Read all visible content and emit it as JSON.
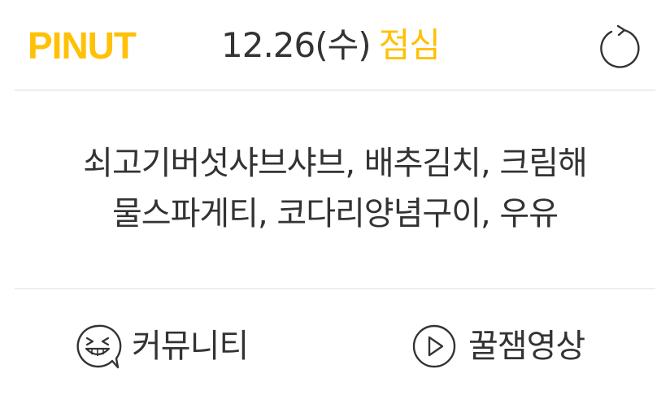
{
  "header": {
    "logo": "PINUT",
    "date": "12.26(수)",
    "meal": "점심",
    "refresh_icon": "refresh-icon"
  },
  "menu": {
    "line1": "쇠고기버섯샤브샤브, 배추김치, 크림해",
    "line2": "물스파게티, 코다리양념구이, 우유"
  },
  "footer": {
    "community_label": "커뮤니티",
    "community_icon": "laughing-face-icon",
    "video_label": "꿀잼영상",
    "video_icon": "play-icon"
  },
  "colors": {
    "accent": "#FFC107",
    "text": "#333333",
    "divider": "#EEEEEE",
    "background": "#FFFFFF"
  }
}
